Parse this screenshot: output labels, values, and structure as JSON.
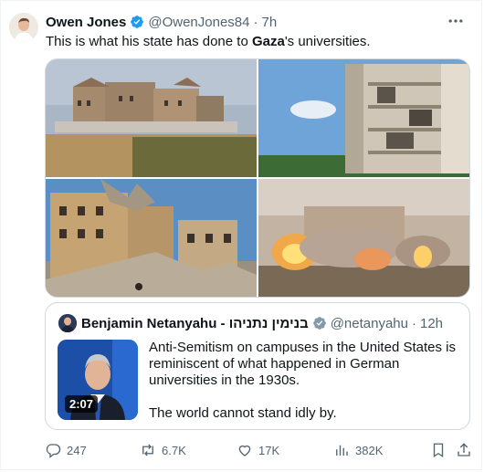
{
  "tweet": {
    "author_name": "Owen Jones",
    "handle": "@OwenJones84",
    "separator": "·",
    "time": "7h",
    "text_before": "This is what his state has done to ",
    "text_bold": "Gaza",
    "text_after": "'s universities."
  },
  "quote": {
    "author_name": "Benjamin Netanyahu - בנימין נתניהו",
    "handle": "@netanyahu",
    "separator": "·",
    "time": "12h",
    "video_duration": "2:07",
    "paragraph1": "Anti-Semitism on campuses in the United States is reminiscent of what happened in German universities in the 1930s.",
    "paragraph2": "The world cannot stand idly by."
  },
  "actions": {
    "replies": "247",
    "reposts": "6.7K",
    "likes": "17K",
    "views": "382K"
  },
  "colors": {
    "verified": "#1d9bf0",
    "secondary_text": "#536471",
    "border": "#cfd9de"
  }
}
